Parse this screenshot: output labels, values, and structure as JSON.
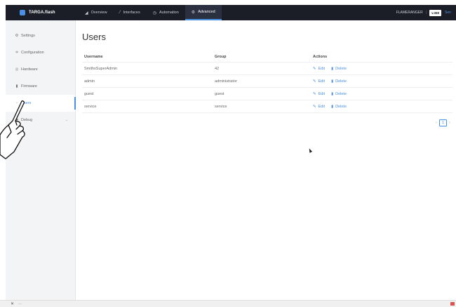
{
  "header": {
    "brand": "TARGA.flash",
    "nav": [
      {
        "label": "Overview",
        "icon": "chart-icon"
      },
      {
        "label": "Interfaces",
        "icon": "pencil-icon"
      },
      {
        "label": "Automation",
        "icon": "clock-icon"
      },
      {
        "label": "Advanced",
        "icon": "gear-icon",
        "active": true
      }
    ],
    "device_name": "FLAMERANGER",
    "separator": "|",
    "firmware_badge": "v.369",
    "user_chip": "Sen"
  },
  "sidebar": {
    "items": [
      {
        "label": "Settings",
        "icon": "gear-icon"
      },
      {
        "label": "Configuration",
        "icon": "sliders-icon"
      },
      {
        "label": "Hardware",
        "icon": "chip-icon"
      },
      {
        "label": "Firmware",
        "icon": "file-icon"
      },
      {
        "label": "Users",
        "icon": "user-icon",
        "active": true
      },
      {
        "label": "Debug",
        "icon": "bug-icon",
        "has_children": true
      }
    ]
  },
  "main": {
    "title": "Users",
    "columns": [
      "Username",
      "Group",
      "Actions"
    ],
    "rows": [
      {
        "username": "SmithsSuperAdmin",
        "group": "42"
      },
      {
        "username": "admin",
        "group": "administrator"
      },
      {
        "username": "guest",
        "group": "guest"
      },
      {
        "username": "service",
        "group": "service"
      }
    ],
    "actions": {
      "edit": "Edit",
      "delete": "Delete"
    },
    "pager": {
      "prev": "‹",
      "current": "1",
      "next": "›"
    }
  },
  "bottombar": {
    "close": "✕",
    "minimize": "—"
  },
  "colors": {
    "accent": "#4a90e2",
    "topbar": "#1b1e27",
    "sidebar": "#f3f4f6"
  }
}
